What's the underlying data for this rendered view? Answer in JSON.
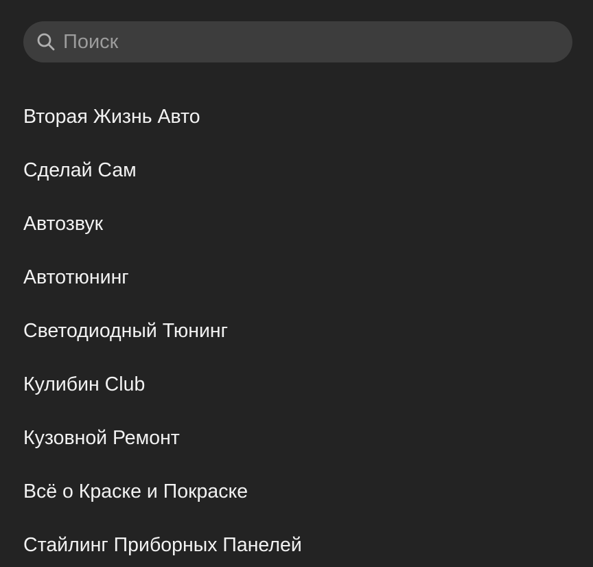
{
  "search": {
    "placeholder": "Поиск",
    "value": "",
    "icon": "search-icon"
  },
  "colors": {
    "background": "#232323",
    "search_background": "#3d3d3d",
    "text": "#f2f2f2",
    "placeholder": "#9c9c9c"
  },
  "list": {
    "items": [
      "Вторая Жизнь Авто",
      "Сделай Сам",
      "Автозвук",
      "Автотюнинг",
      "Светодиодный Тюнинг",
      "Кулибин Club",
      "Кузовной Ремонт",
      "Всё о Краске и Покраске",
      "Стайлинг Приборных Панелей"
    ]
  }
}
